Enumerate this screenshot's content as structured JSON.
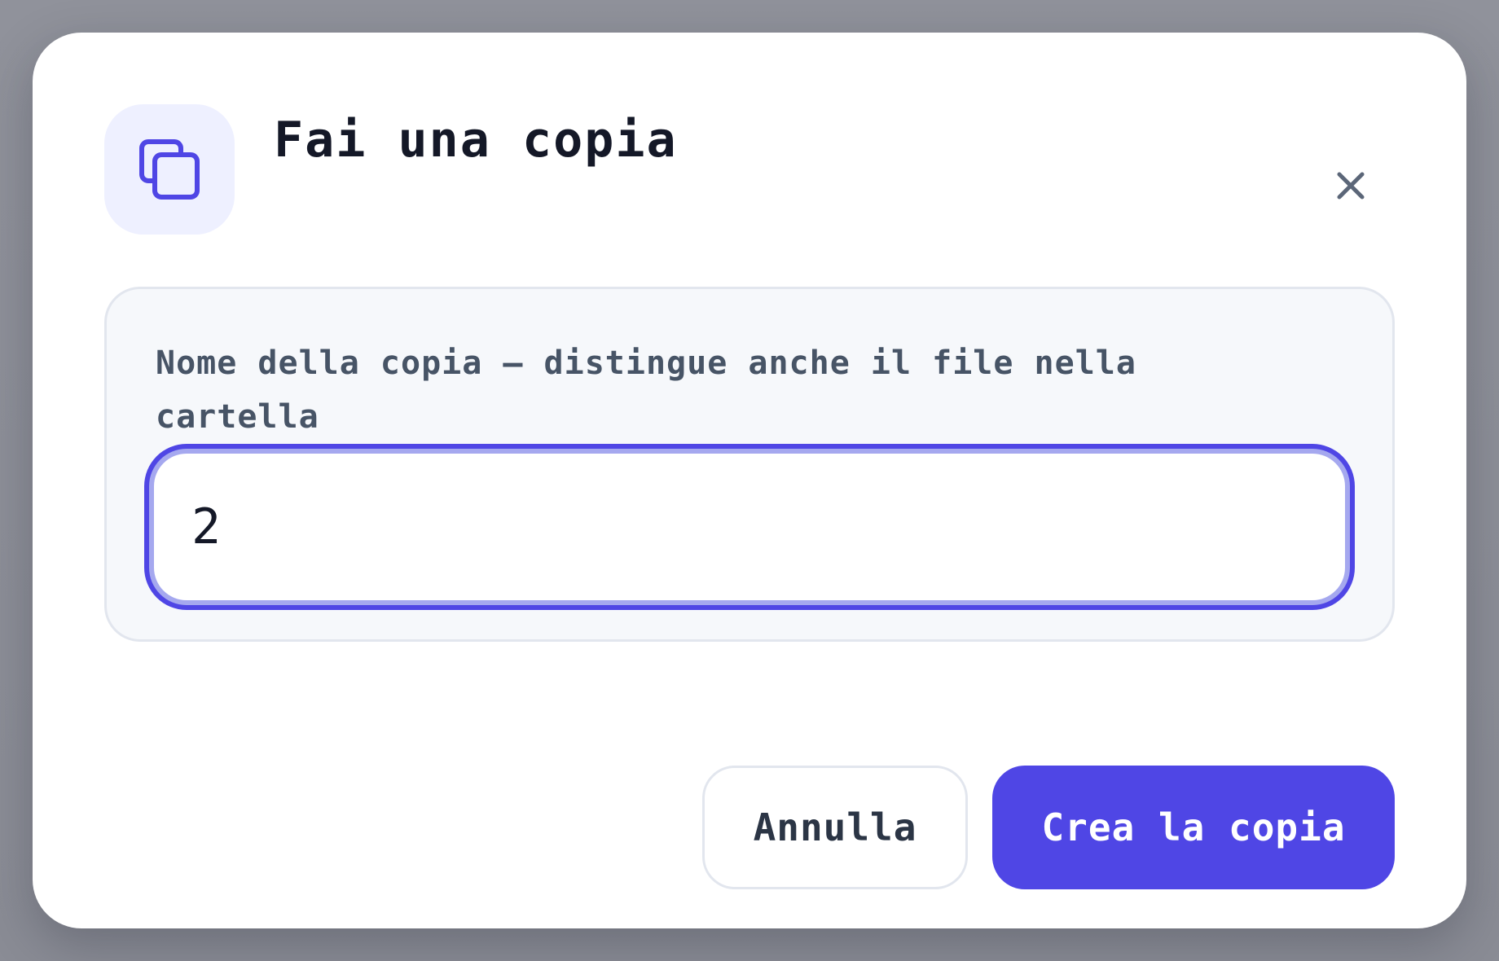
{
  "dialog": {
    "title": "Fai una copia",
    "icon": "copy-icon",
    "close_icon": "close-icon"
  },
  "field": {
    "label": "Nome della copia — distingue anche il file nella cartella",
    "value": "2"
  },
  "actions": {
    "cancel_label": "Annulla",
    "confirm_label": "Crea la copia"
  },
  "colors": {
    "accent": "#4f46e5",
    "accent_ring": "#a5a8ef",
    "icon_tile_bg": "#eef0ff",
    "title_text": "#141827",
    "label_text": "#475466",
    "card_bg": "#f6f8fb",
    "border": "#e2e6ee",
    "backdrop": "#8d9099"
  }
}
